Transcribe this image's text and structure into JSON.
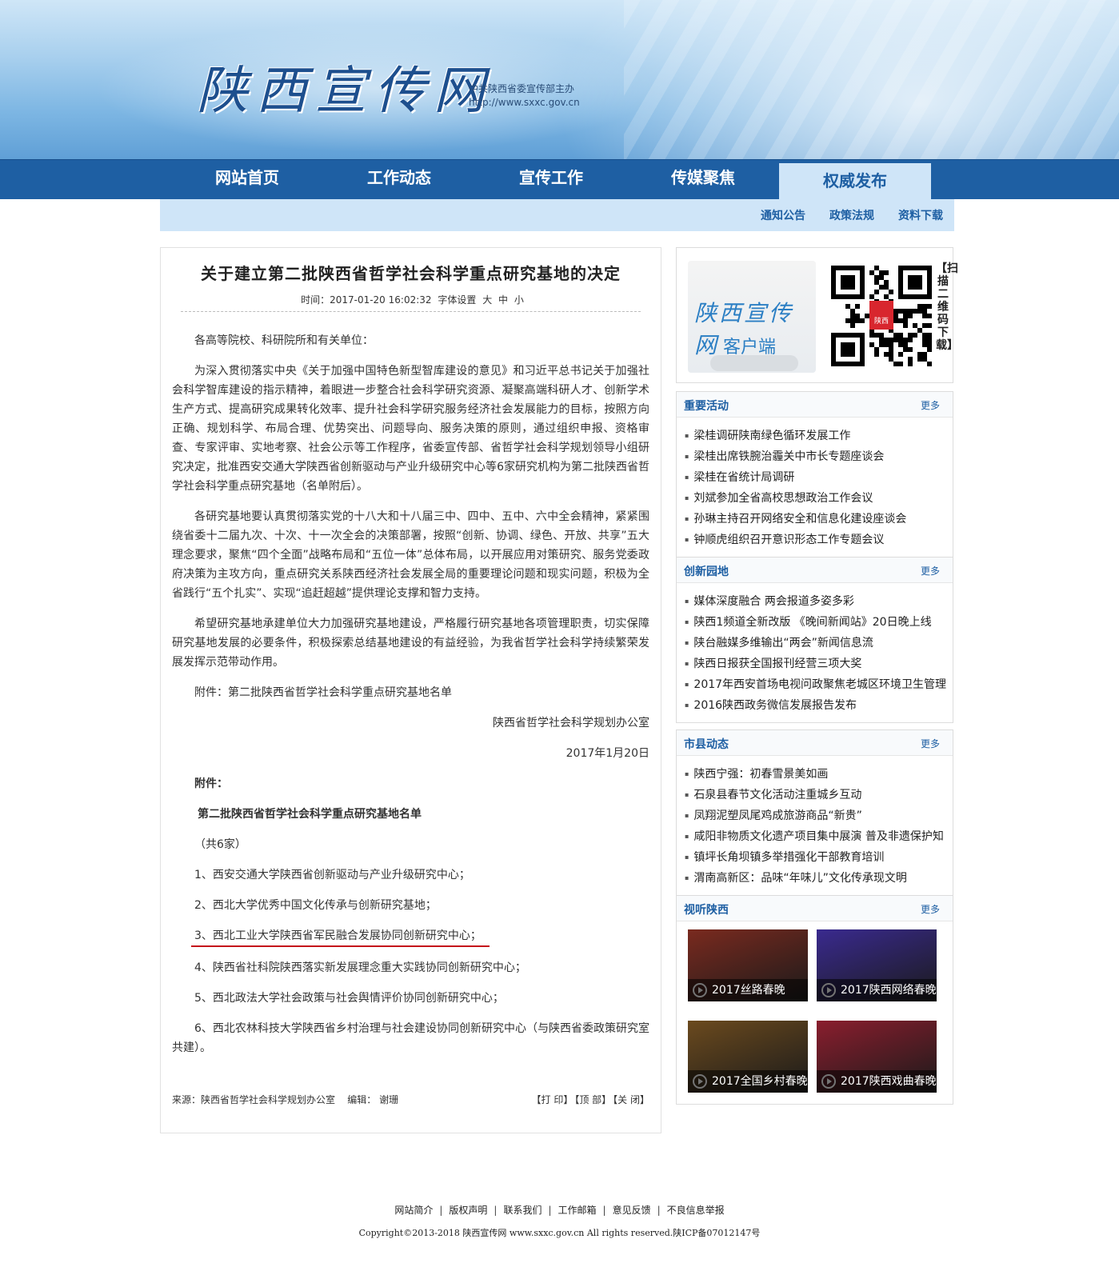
{
  "header": {
    "logo": "陕西宣传网",
    "sub_line1": "中共陕西省委宣传部主办",
    "sub_line2": "http://www.sxxc.gov.cn"
  },
  "nav": {
    "items": [
      "网站首页",
      "工作动态",
      "宣传工作",
      "传媒聚焦",
      "权威发布"
    ],
    "active": "权威发布"
  },
  "subnav": [
    "通知公告",
    "政策法规",
    "资料下载"
  ],
  "article": {
    "title": "关于建立第二批陕西省哲学社会科学重点研究基地的决定",
    "meta_time": "时间：2017-01-20 16:02:32",
    "meta_font": "字体设置",
    "font_big": "大",
    "font_mid": "中",
    "font_small": "小",
    "paragraphs": [
      "各高等院校、科研院所和有关单位：",
      "为深入贯彻落实中央《关于加强中国特色新型智库建设的意见》和习近平总书记关于加强社会科学智库建设的指示精神，着眼进一步整合社会科学研究资源、凝聚高端科研人才、创新学术生产方式、提高研究成果转化效率、提升社会科学研究服务经济社会发展能力的目标，按照方向正确、规划科学、布局合理、优势突出、问题导向、服务决策的原则，通过组织申报、资格审查、专家评审、实地考察、社会公示等工作程序，省委宣传部、省哲学社会科学规划领导小组研究决定，批准西安交通大学陕西省创新驱动与产业升级研究中心等6家研究机构为第二批陕西省哲学社会科学重点研究基地（名单附后）。",
      "各研究基地要认真贯彻落实党的十八大和十八届三中、四中、五中、六中全会精神，紧紧围绕省委十二届九次、十次、十一次全会的决策部署，按照“创新、协调、绿色、开放、共享”五大理念要求，聚焦“四个全面”战略布局和“五位一体”总体布局，以开展应用对策研究、服务党委政府决策为主攻方向，重点研究关系陕西经济社会发展全局的重要理论问题和现实问题，积极为全省践行“五个扎实”、实现“追赶超越”提供理论支撑和智力支持。",
      "希望研究基地承建单位大力加强研究基地建设，严格履行研究基地各项管理职责，切实保障研究基地发展的必要条件，积极探索总结基地建设的有益经验，为我省哲学社会科学持续繁荣发展发挥示范带动作用。",
      "附件：第二批陕西省哲学社会科学重点研究基地名单"
    ],
    "signer": "陕西省哲学社会科学规划办公室",
    "date": "2017年1月20日",
    "attach_label": "附件：",
    "list_title": "第二批陕西省哲学社会科学重点研究基地名单",
    "count": "（共6家）",
    "list": [
      "1、西安交通大学陕西省创新驱动与产业升级研究中心；",
      "2、西北大学优秀中国文化传承与创新研究基地；",
      "3、西北工业大学陕西省军民融合发展协同创新研究中心；",
      "4、陕西省社科院陕西落实新发展理念重大实践协同创新研究中心；",
      "5、西北政法大学社会政策与社会舆情评价协同创新研究中心；",
      "6、西北农林科技大学陕西省乡村治理与社会建设协同创新研究中心（与陕西省委政策研究室共建）。"
    ],
    "source": "来源：陕西省哲学社会科学规划办公室",
    "editor": "编辑：  谢珊",
    "print": "【打 印】",
    "top": "【顶 部】",
    "close": "【关 闭】"
  },
  "sidebar": {
    "client_logo": "陕西宣传网",
    "client_sub": "客户端",
    "qr_caption": "【扫描二维码下载】",
    "qr_badge": "陕西",
    "more": "更多",
    "panels": [
      {
        "title": "重要活动",
        "items": [
          "梁桂调研陕南绿色循环发展工作",
          "梁桂出席铁腕治霾关中市长专题座谈会",
          "梁桂在省统计局调研",
          "刘斌参加全省高校思想政治工作会议",
          "孙琳主持召开网络安全和信息化建设座谈会",
          "钟顺虎组织召开意识形态工作专题会议"
        ]
      },
      {
        "title": "创新园地",
        "items": [
          "媒体深度融合  两会报道多姿多彩",
          "陕西1频道全新改版 《晚间新闻站》20日晚上线",
          "陕台融媒多维输出“两会”新闻信息流",
          "陕西日报获全国报刊经营三项大奖",
          "2017年西安首场电视问政聚焦老城区环境卫生管理",
          "2016陕西政务微信发展报告发布"
        ]
      },
      {
        "title": "市县动态",
        "items": [
          "陕西宁强：初春雪景美如画",
          "石泉县春节文化活动注重城乡互动",
          "凤翔泥塑凤尾鸡成旅游商品“新贵”",
          "咸阳非物质文化遗产项目集中展演 普及非遗保护知",
          "镇坪长角坝镇多举措强化干部教育培训",
          "渭南高新区：品味“年味儿”文化传承现文明"
        ]
      }
    ],
    "video_panel": {
      "title": "视听陕西",
      "videos": [
        {
          "caption": "2017丝路春晚",
          "color": "#7a2a1f"
        },
        {
          "caption": "2017陕西网络春晚",
          "color": "#3a2a8f"
        },
        {
          "caption": "2017全国乡村春晚",
          "color": "#6b4a1e"
        },
        {
          "caption": "2017陕西戏曲春晚",
          "color": "#8a1e2e"
        }
      ]
    }
  },
  "footer": {
    "links": [
      "网站简介",
      "版权声明",
      "联系我们",
      "工作邮箱",
      "意见反馈",
      "不良信息举报"
    ],
    "copyright": "Copyright©2013-2018 陕西宣传网 www.sxxc.gov.cn All rights reserved.陕ICP备07012147号"
  }
}
